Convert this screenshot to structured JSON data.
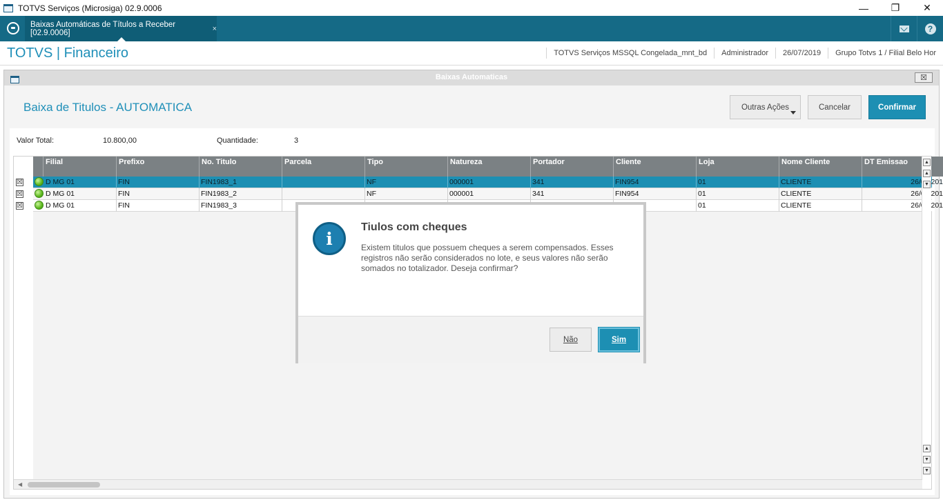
{
  "window": {
    "title": "TOTVS Serviços (Microsiga) 02.9.0006",
    "minimize": "—",
    "maximize": "❐",
    "close": "✕"
  },
  "tabbar": {
    "tab_label": "Baixas Automáticas de Títulos a Receber [02.9.0006]",
    "tab_close": "×"
  },
  "module": {
    "title": "TOTVS | Financeiro",
    "environment": "TOTVS Serviços MSSQL Congelada_mnt_bd",
    "user": "Administrador",
    "date": "26/07/2019",
    "branch": "Grupo Totvs 1 / Filial Belo Hor"
  },
  "dialog": {
    "window_title": "Baixas Automaticas",
    "close": "☒",
    "heading": "Baixa de Titulos - AUTOMATICA",
    "buttons": {
      "more_actions": "Outras Ações",
      "cancel": "Cancelar",
      "confirm": "Confirmar"
    }
  },
  "summary": {
    "total_label": "Valor Total:",
    "total_value": "10.800,00",
    "qty_label": "Quantidade:",
    "qty_value": "3"
  },
  "grid": {
    "columns": [
      "Filial",
      "Prefixo",
      "No. Titulo",
      "Parcela",
      "Tipo",
      "Natureza",
      "Portador",
      "Cliente",
      "Loja",
      "Nome Cliente",
      "DT Emissao"
    ],
    "rows": [
      {
        "checked": "☒",
        "filial": "D MG 01",
        "prefixo": "FIN",
        "titulo": "FIN1983_1",
        "parcela": "",
        "tipo": "NF",
        "natureza": "000001",
        "portador": "341",
        "cliente": "FIN954",
        "loja": "01",
        "nome": "CLIENTE",
        "emissao": "26/07/201"
      },
      {
        "checked": "☒",
        "filial": "D MG 01",
        "prefixo": "FIN",
        "titulo": "FIN1983_2",
        "parcela": "",
        "tipo": "NF",
        "natureza": "000001",
        "portador": "341",
        "cliente": "FIN954",
        "loja": "01",
        "nome": "CLIENTE",
        "emissao": "26/07/201"
      },
      {
        "checked": "☒",
        "filial": "D MG 01",
        "prefixo": "FIN",
        "titulo": "FIN1983_3",
        "parcela": "",
        "tipo": "",
        "natureza": "",
        "portador": "",
        "cliente": "",
        "loja": "01",
        "nome": "CLIENTE",
        "emissao": "26/07/201"
      }
    ]
  },
  "message": {
    "title": "Tiulos com cheques",
    "text": "Existem titulos que possuem cheques a serem compensados. Esses registros não serão considerados no lote, e seus valores não serão somados no totalizador. Deseja confirmar?",
    "icon_glyph": "i",
    "no_label": "Não",
    "yes_label": "Sim"
  }
}
